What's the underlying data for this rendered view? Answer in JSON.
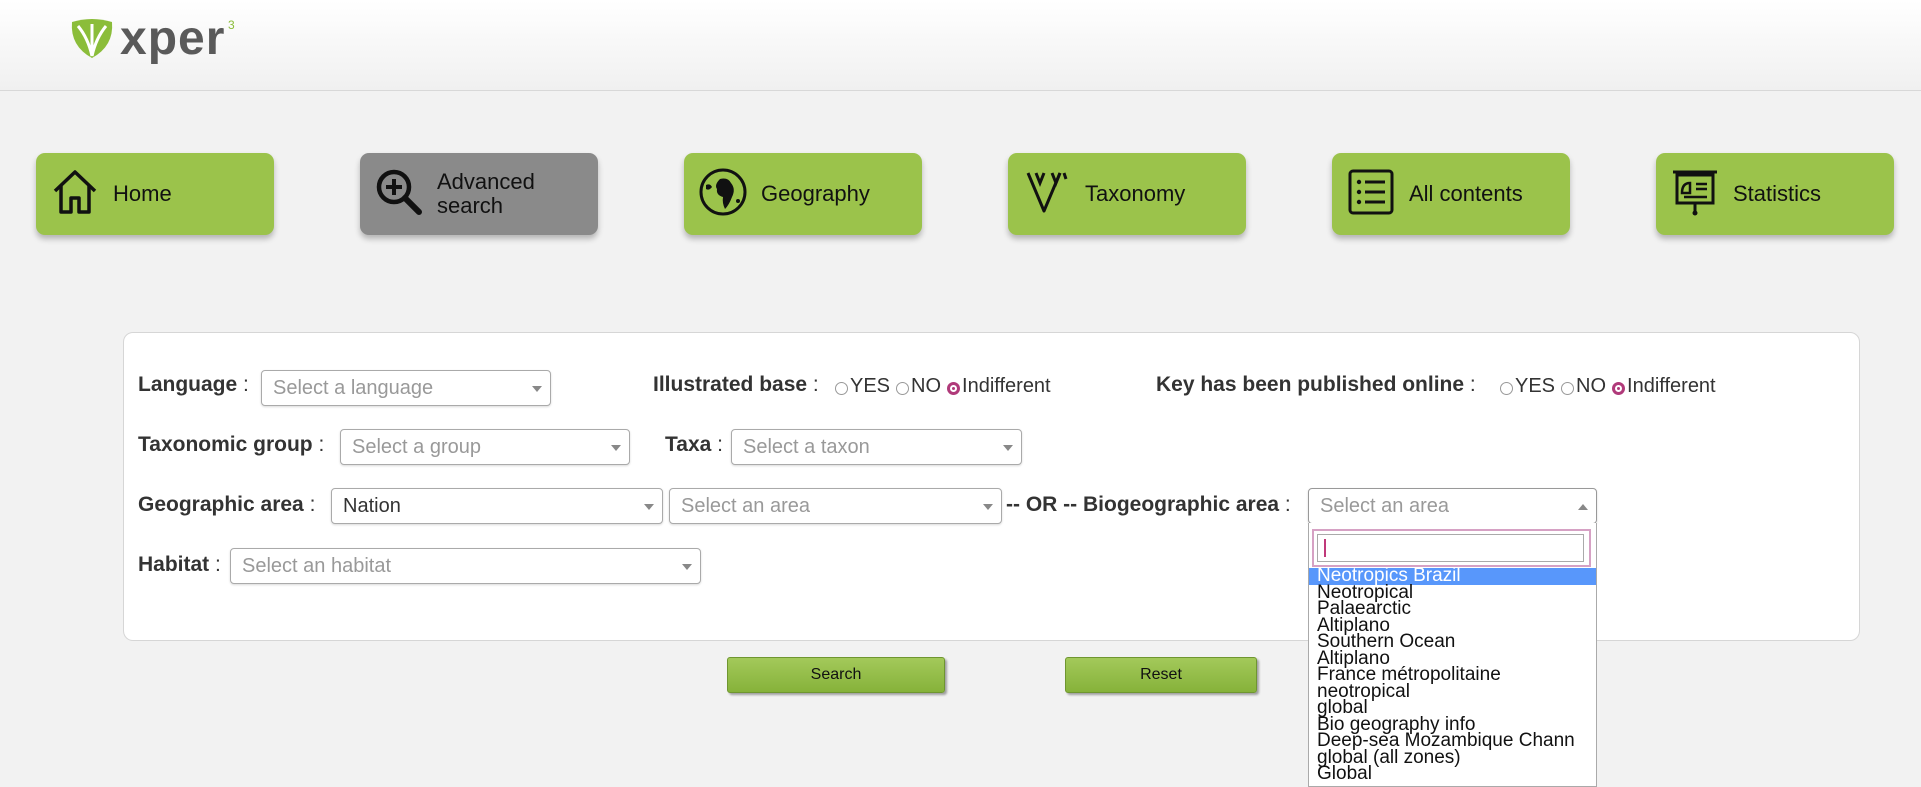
{
  "brand": {
    "name": "xper",
    "version": "3"
  },
  "nav": [
    {
      "label": "Home",
      "icon": "home-icon"
    },
    {
      "label": "Advanced search",
      "icon": "magnify-plus-icon",
      "active": true
    },
    {
      "label": "Geography",
      "icon": "globe-icon"
    },
    {
      "label": "Taxonomy",
      "icon": "taxonomy-tree-icon"
    },
    {
      "label": "All contents",
      "icon": "list-icon"
    },
    {
      "label": "Statistics",
      "icon": "presentation-icon"
    }
  ],
  "form": {
    "language": {
      "label": "Language",
      "sep": ":",
      "placeholder": "Select a language"
    },
    "illustrated": {
      "label": "Illustrated base",
      "sep": ":",
      "options": [
        "YES",
        "NO",
        "Indifferent"
      ],
      "selected": "Indifferent"
    },
    "published": {
      "label": "Key has been published online",
      "sep": ":",
      "options": [
        "YES",
        "NO",
        "Indifferent"
      ],
      "selected": "Indifferent"
    },
    "taxgroup": {
      "label": "Taxonomic group",
      "sep": ":",
      "placeholder": "Select a group"
    },
    "taxa": {
      "label": "Taxa",
      "sep": ":",
      "placeholder": "Select a taxon"
    },
    "geo": {
      "label": "Geographic area",
      "sep": ":",
      "level": "Nation",
      "placeholder": "Select an area",
      "or": "-- OR --"
    },
    "biogeo": {
      "label": "Biogeographic area",
      "sep": ":",
      "placeholder": "Select an area"
    },
    "habitat": {
      "label": "Habitat",
      "sep": ":",
      "placeholder": "Select an habitat"
    }
  },
  "buttons": {
    "search": "Search",
    "reset": "Reset"
  },
  "dropdown": {
    "search_value": "",
    "items": [
      "Neotropics Brazil",
      "Neotropical",
      "Palaearctic",
      "Altiplano",
      "Southern Ocean",
      "Altiplano",
      "France métropolitaine",
      "neotropical",
      "global",
      "Bio geography info",
      "Deep-sea Mozambique Chann",
      "global (all zones)",
      "Global"
    ],
    "highlighted": 0
  },
  "colors": {
    "nav_green": "#9bc34b",
    "nav_active": "#8a8a8a",
    "radio_accent": "#b03a7a",
    "highlight": "#5897fb"
  }
}
